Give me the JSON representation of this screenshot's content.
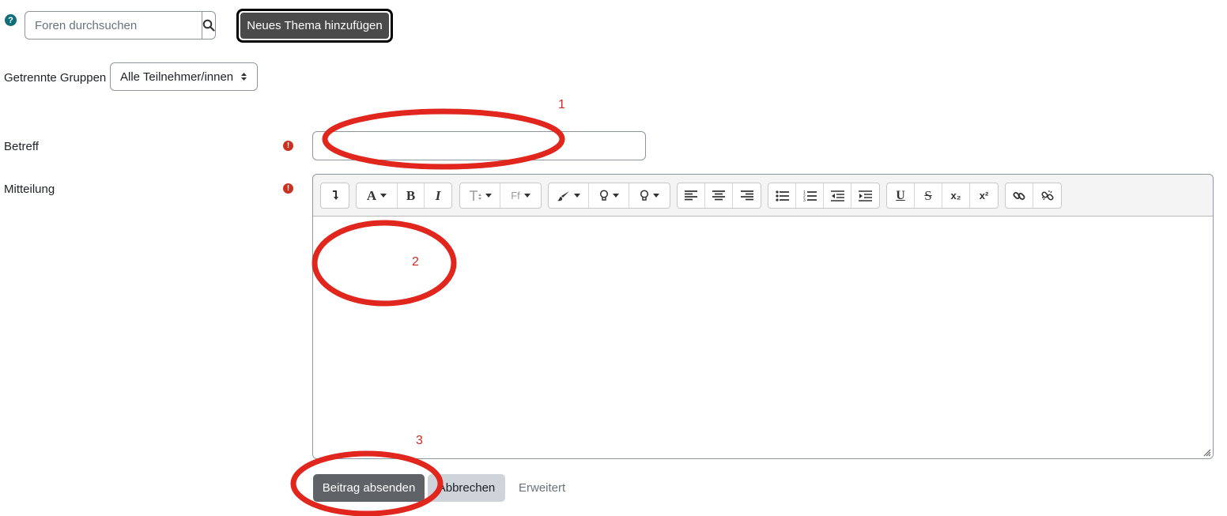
{
  "search": {
    "placeholder": "Foren durchsuchen",
    "help_icon": "?",
    "button_icon": "search-icon"
  },
  "new_topic_button": "Neues Thema hinzufügen",
  "groups": {
    "label": "Getrennte Gruppen",
    "selected": "Alle Teilnehmer/innen"
  },
  "form": {
    "subject_label": "Betreff",
    "message_label": "Mitteilung",
    "required_icon": "!",
    "subject_value": ""
  },
  "toolbar": {
    "icons": [
      "collapse-icon",
      "font-color-icon",
      "bold-icon",
      "italic-icon",
      "font-size-icon",
      "font-family-icon",
      "brush-icon",
      "lightbulb-icon",
      "lightbulb-icon",
      "align-left-icon",
      "align-center-icon",
      "align-right-icon",
      "unordered-list-icon",
      "ordered-list-icon",
      "outdent-icon",
      "indent-icon",
      "underline-icon",
      "strikethrough-icon",
      "subscript-icon",
      "superscript-icon",
      "link-icon",
      "unlink-icon"
    ],
    "bold": "B",
    "italic": "I",
    "font_color": "A",
    "underline": "U",
    "strike": "S",
    "subscript": "x₂",
    "superscript": "x²",
    "font_family": "Ff"
  },
  "actions": {
    "submit": "Beitrag absenden",
    "cancel": "Abbrechen",
    "advanced": "Erweitert"
  },
  "annotations": {
    "one": "1",
    "two": "2",
    "three": "3",
    "color": "#d02a21"
  }
}
